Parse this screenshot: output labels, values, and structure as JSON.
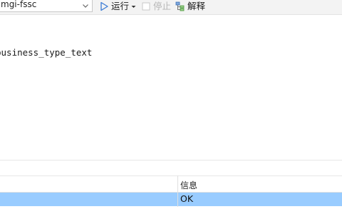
{
  "toolbar": {
    "database_select": {
      "value": "mgi-fssc"
    },
    "run_label": "运行",
    "stop_label": "停止",
    "explain_label": "解释"
  },
  "editor": {
    "visible_text": "business_type_text"
  },
  "results": {
    "columns": [
      "",
      "信息"
    ],
    "rows": [
      {
        "cells": [
          "",
          "OK"
        ],
        "selected": true
      }
    ]
  },
  "colors": {
    "toolbar_bg": "#f3f3f3",
    "selected_row": "#99ccff",
    "run_icon": "#3a7bd5",
    "disabled_text": "#b5b5b5"
  },
  "icons": {
    "run": "play-icon",
    "stop": "stop-checkbox-icon",
    "explain": "explain-plan-icon",
    "dropdown": "chevron-down-icon"
  }
}
